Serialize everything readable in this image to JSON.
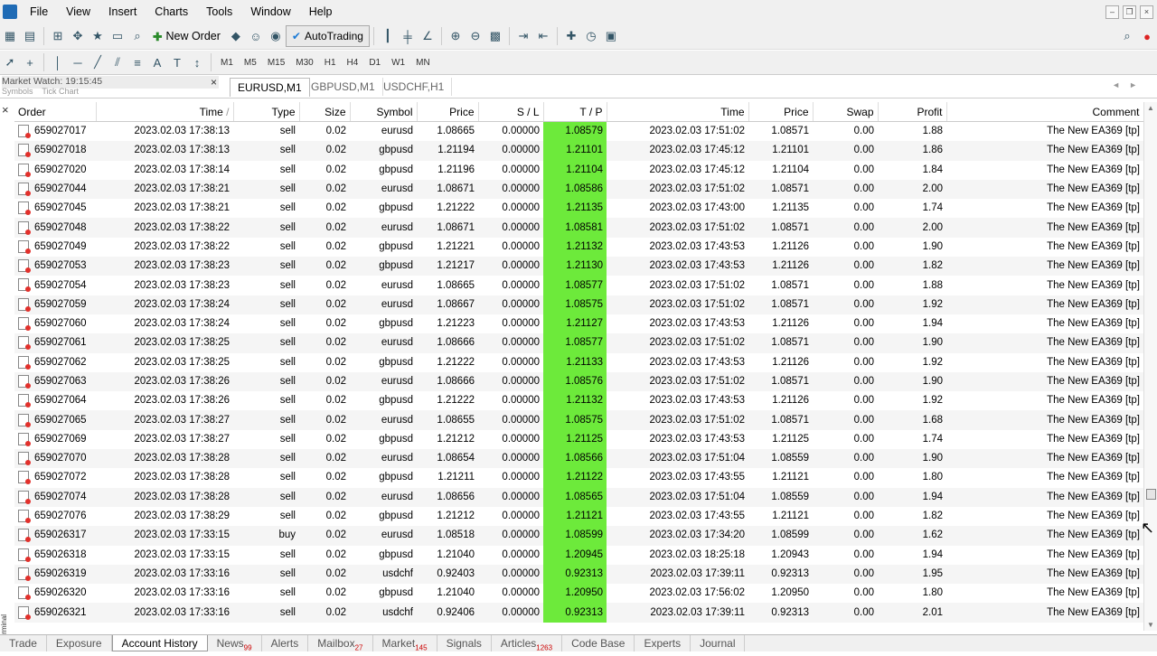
{
  "menu": [
    "File",
    "View",
    "Insert",
    "Charts",
    "Tools",
    "Window",
    "Help"
  ],
  "toolbar": {
    "new_order": "New Order",
    "autotrading": "AutoTrading",
    "timeframes": [
      "M1",
      "M5",
      "M15",
      "M30",
      "H1",
      "H4",
      "D1",
      "W1",
      "MN"
    ]
  },
  "market_watch": {
    "title": "Market Watch: 19:15:45",
    "sub_tabs": [
      "Symbols",
      "Tick Chart"
    ]
  },
  "chart_tabs": [
    "EURUSD,M1",
    "GBPUSD,M1",
    "USDCHF,H1"
  ],
  "side_label": "Terminal",
  "columns": [
    "Order",
    "Time",
    "Type",
    "Size",
    "Symbol",
    "Price",
    "S / L",
    "T / P",
    "Time",
    "Price",
    "Swap",
    "Profit",
    "Comment"
  ],
  "rows": [
    [
      "659027017",
      "2023.02.03 17:38:13",
      "sell",
      "0.02",
      "eurusd",
      "1.08665",
      "0.00000",
      "1.08579",
      "2023.02.03 17:51:02",
      "1.08571",
      "0.00",
      "1.88",
      "The New EA369 [tp]"
    ],
    [
      "659027018",
      "2023.02.03 17:38:13",
      "sell",
      "0.02",
      "gbpusd",
      "1.21194",
      "0.00000",
      "1.21101",
      "2023.02.03 17:45:12",
      "1.21101",
      "0.00",
      "1.86",
      "The New EA369 [tp]"
    ],
    [
      "659027020",
      "2023.02.03 17:38:14",
      "sell",
      "0.02",
      "gbpusd",
      "1.21196",
      "0.00000",
      "1.21104",
      "2023.02.03 17:45:12",
      "1.21104",
      "0.00",
      "1.84",
      "The New EA369 [tp]"
    ],
    [
      "659027044",
      "2023.02.03 17:38:21",
      "sell",
      "0.02",
      "eurusd",
      "1.08671",
      "0.00000",
      "1.08586",
      "2023.02.03 17:51:02",
      "1.08571",
      "0.00",
      "2.00",
      "The New EA369 [tp]"
    ],
    [
      "659027045",
      "2023.02.03 17:38:21",
      "sell",
      "0.02",
      "gbpusd",
      "1.21222",
      "0.00000",
      "1.21135",
      "2023.02.03 17:43:00",
      "1.21135",
      "0.00",
      "1.74",
      "The New EA369 [tp]"
    ],
    [
      "659027048",
      "2023.02.03 17:38:22",
      "sell",
      "0.02",
      "eurusd",
      "1.08671",
      "0.00000",
      "1.08581",
      "2023.02.03 17:51:02",
      "1.08571",
      "0.00",
      "2.00",
      "The New EA369 [tp]"
    ],
    [
      "659027049",
      "2023.02.03 17:38:22",
      "sell",
      "0.02",
      "gbpusd",
      "1.21221",
      "0.00000",
      "1.21132",
      "2023.02.03 17:43:53",
      "1.21126",
      "0.00",
      "1.90",
      "The New EA369 [tp]"
    ],
    [
      "659027053",
      "2023.02.03 17:38:23",
      "sell",
      "0.02",
      "gbpusd",
      "1.21217",
      "0.00000",
      "1.21130",
      "2023.02.03 17:43:53",
      "1.21126",
      "0.00",
      "1.82",
      "The New EA369 [tp]"
    ],
    [
      "659027054",
      "2023.02.03 17:38:23",
      "sell",
      "0.02",
      "eurusd",
      "1.08665",
      "0.00000",
      "1.08577",
      "2023.02.03 17:51:02",
      "1.08571",
      "0.00",
      "1.88",
      "The New EA369 [tp]"
    ],
    [
      "659027059",
      "2023.02.03 17:38:24",
      "sell",
      "0.02",
      "eurusd",
      "1.08667",
      "0.00000",
      "1.08575",
      "2023.02.03 17:51:02",
      "1.08571",
      "0.00",
      "1.92",
      "The New EA369 [tp]"
    ],
    [
      "659027060",
      "2023.02.03 17:38:24",
      "sell",
      "0.02",
      "gbpusd",
      "1.21223",
      "0.00000",
      "1.21127",
      "2023.02.03 17:43:53",
      "1.21126",
      "0.00",
      "1.94",
      "The New EA369 [tp]"
    ],
    [
      "659027061",
      "2023.02.03 17:38:25",
      "sell",
      "0.02",
      "eurusd",
      "1.08666",
      "0.00000",
      "1.08577",
      "2023.02.03 17:51:02",
      "1.08571",
      "0.00",
      "1.90",
      "The New EA369 [tp]"
    ],
    [
      "659027062",
      "2023.02.03 17:38:25",
      "sell",
      "0.02",
      "gbpusd",
      "1.21222",
      "0.00000",
      "1.21133",
      "2023.02.03 17:43:53",
      "1.21126",
      "0.00",
      "1.92",
      "The New EA369 [tp]"
    ],
    [
      "659027063",
      "2023.02.03 17:38:26",
      "sell",
      "0.02",
      "eurusd",
      "1.08666",
      "0.00000",
      "1.08576",
      "2023.02.03 17:51:02",
      "1.08571",
      "0.00",
      "1.90",
      "The New EA369 [tp]"
    ],
    [
      "659027064",
      "2023.02.03 17:38:26",
      "sell",
      "0.02",
      "gbpusd",
      "1.21222",
      "0.00000",
      "1.21132",
      "2023.02.03 17:43:53",
      "1.21126",
      "0.00",
      "1.92",
      "The New EA369 [tp]"
    ],
    [
      "659027065",
      "2023.02.03 17:38:27",
      "sell",
      "0.02",
      "eurusd",
      "1.08655",
      "0.00000",
      "1.08575",
      "2023.02.03 17:51:02",
      "1.08571",
      "0.00",
      "1.68",
      "The New EA369 [tp]"
    ],
    [
      "659027069",
      "2023.02.03 17:38:27",
      "sell",
      "0.02",
      "gbpusd",
      "1.21212",
      "0.00000",
      "1.21125",
      "2023.02.03 17:43:53",
      "1.21125",
      "0.00",
      "1.74",
      "The New EA369 [tp]"
    ],
    [
      "659027070",
      "2023.02.03 17:38:28",
      "sell",
      "0.02",
      "eurusd",
      "1.08654",
      "0.00000",
      "1.08566",
      "2023.02.03 17:51:04",
      "1.08559",
      "0.00",
      "1.90",
      "The New EA369 [tp]"
    ],
    [
      "659027072",
      "2023.02.03 17:38:28",
      "sell",
      "0.02",
      "gbpusd",
      "1.21211",
      "0.00000",
      "1.21122",
      "2023.02.03 17:43:55",
      "1.21121",
      "0.00",
      "1.80",
      "The New EA369 [tp]"
    ],
    [
      "659027074",
      "2023.02.03 17:38:28",
      "sell",
      "0.02",
      "eurusd",
      "1.08656",
      "0.00000",
      "1.08565",
      "2023.02.03 17:51:04",
      "1.08559",
      "0.00",
      "1.94",
      "The New EA369 [tp]"
    ],
    [
      "659027076",
      "2023.02.03 17:38:29",
      "sell",
      "0.02",
      "gbpusd",
      "1.21212",
      "0.00000",
      "1.21121",
      "2023.02.03 17:43:55",
      "1.21121",
      "0.00",
      "1.82",
      "The New EA369 [tp]"
    ],
    [
      "659026317",
      "2023.02.03 17:33:15",
      "buy",
      "0.02",
      "eurusd",
      "1.08518",
      "0.00000",
      "1.08599",
      "2023.02.03 17:34:20",
      "1.08599",
      "0.00",
      "1.62",
      "The New EA369 [tp]"
    ],
    [
      "659026318",
      "2023.02.03 17:33:15",
      "sell",
      "0.02",
      "gbpusd",
      "1.21040",
      "0.00000",
      "1.20945",
      "2023.02.03 18:25:18",
      "1.20943",
      "0.00",
      "1.94",
      "The New EA369 [tp]"
    ],
    [
      "659026319",
      "2023.02.03 17:33:16",
      "sell",
      "0.02",
      "usdchf",
      "0.92403",
      "0.00000",
      "0.92313",
      "2023.02.03 17:39:11",
      "0.92313",
      "0.00",
      "1.95",
      "The New EA369 [tp]"
    ],
    [
      "659026320",
      "2023.02.03 17:33:16",
      "sell",
      "0.02",
      "gbpusd",
      "1.21040",
      "0.00000",
      "1.20950",
      "2023.02.03 17:56:02",
      "1.20950",
      "0.00",
      "1.80",
      "The New EA369 [tp]"
    ],
    [
      "659026321",
      "2023.02.03 17:33:16",
      "sell",
      "0.02",
      "usdchf",
      "0.92406",
      "0.00000",
      "0.92313",
      "2023.02.03 17:39:11",
      "0.92313",
      "0.00",
      "2.01",
      "The New EA369 [tp]"
    ]
  ],
  "bottom_tabs": [
    {
      "label": "Trade",
      "count": ""
    },
    {
      "label": "Exposure",
      "count": ""
    },
    {
      "label": "Account History",
      "count": ""
    },
    {
      "label": "News",
      "count": "99"
    },
    {
      "label": "Alerts",
      "count": ""
    },
    {
      "label": "Mailbox",
      "count": "27"
    },
    {
      "label": "Market",
      "count": "145"
    },
    {
      "label": "Signals",
      "count": ""
    },
    {
      "label": "Articles",
      "count": "1263"
    },
    {
      "label": "Code Base",
      "count": ""
    },
    {
      "label": "Experts",
      "count": ""
    },
    {
      "label": "Journal",
      "count": ""
    }
  ],
  "active_bottom_tab": "Account History",
  "colors": {
    "tp_highlight": "#6dea3b"
  }
}
